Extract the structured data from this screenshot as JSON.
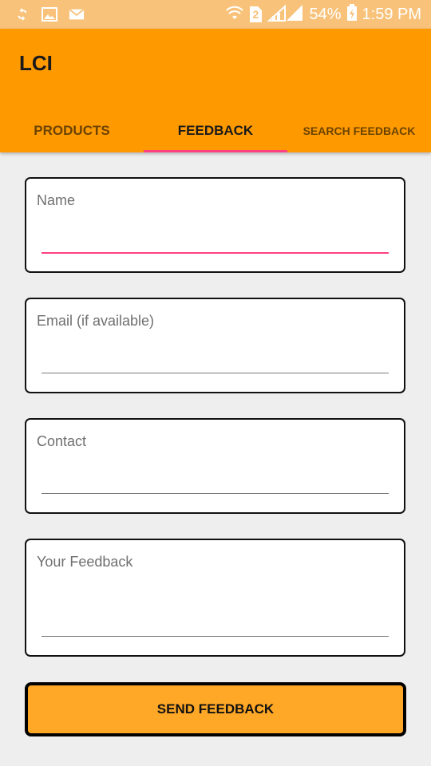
{
  "status_bar": {
    "battery_percent": "54%",
    "time": "1:59 PM",
    "sim_label": "2"
  },
  "app": {
    "title": "LCI"
  },
  "tabs": [
    {
      "label": "PRODUCTS",
      "active": false
    },
    {
      "label": "FEEDBACK",
      "active": true
    },
    {
      "label": "SEARCH FEEDBACK",
      "active": false
    }
  ],
  "form": {
    "name_label": "Name",
    "name_value": "",
    "email_label": "Email (if available)",
    "email_value": "",
    "contact_label": "Contact",
    "contact_value": "",
    "feedback_label": "Your Feedback",
    "feedback_value": ""
  },
  "actions": {
    "send_label": "SEND FEEDBACK"
  },
  "colors": {
    "primary": "#ff9900",
    "status_bar": "#f8c27a",
    "accent": "#ff4081",
    "button": "#ffa726",
    "background": "#eeeeee"
  }
}
